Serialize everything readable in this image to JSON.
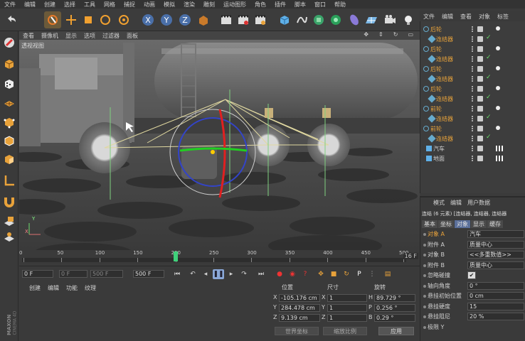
{
  "menu": [
    "文件",
    "编辑",
    "创建",
    "选择",
    "工具",
    "网格",
    "捕捉",
    "动画",
    "模拟",
    "渲染",
    "雕刻",
    "运动图形",
    "角色",
    "插件",
    "脚本",
    "窗口",
    "帮助"
  ],
  "viewport": {
    "menu": [
      "查看",
      "摄像机",
      "显示",
      "选项",
      "过滤器",
      "面板"
    ],
    "title": "透视视图",
    "axis_y": "Y",
    "axis_x": "X"
  },
  "object_manager": {
    "menu": [
      "文件",
      "编辑",
      "查看",
      "对象",
      "标签"
    ],
    "objects": [
      {
        "name": "后轮",
        "type": "null",
        "color": "#e8a23a"
      },
      {
        "name": "连结器",
        "type": "connector",
        "color": "#e8a23a"
      },
      {
        "name": "后轮",
        "type": "null",
        "color": "#e8a23a"
      },
      {
        "name": "连结器",
        "type": "connector",
        "color": "#e8a23a"
      },
      {
        "name": "后轮",
        "type": "null",
        "color": "#e8a23a"
      },
      {
        "name": "连结器",
        "type": "connector",
        "color": "#e8a23a"
      },
      {
        "name": "后轮",
        "type": "null",
        "color": "#e8a23a"
      },
      {
        "name": "连结器",
        "type": "connector",
        "color": "#e8a23a"
      },
      {
        "name": "前轮",
        "type": "null",
        "color": "#e8a23a"
      },
      {
        "name": "连结器",
        "type": "connector",
        "color": "#e8a23a"
      },
      {
        "name": "前轮",
        "type": "null",
        "color": "#e8a23a"
      },
      {
        "name": "连结器",
        "type": "connector",
        "color": "#e8a23a"
      },
      {
        "name": "汽车",
        "type": "object",
        "color": "#d0d0d0"
      },
      {
        "name": "地面",
        "type": "object",
        "color": "#d0d0d0"
      }
    ]
  },
  "attributes": {
    "menu": [
      "模式",
      "编辑",
      "用户数据"
    ],
    "header": "连结 (6 元素) [连结器, 连结器, 连结器",
    "tabs": [
      "基本",
      "坐标",
      "对象",
      "显示",
      "缓存"
    ],
    "active_tab": "对象",
    "rows": [
      {
        "label": "对象 A",
        "value": "汽车"
      },
      {
        "label": "附件 A",
        "value": "质量中心"
      },
      {
        "label": "对象 B",
        "value": "<<多重数值>>"
      },
      {
        "label": "附件 B",
        "value": "质量中心"
      },
      {
        "label": "忽略碰撞",
        "value": "✔"
      },
      {
        "label": "轴向角度",
        "value": "0 °"
      },
      {
        "label": "悬挂初始位置",
        "value": "0 cm"
      },
      {
        "label": "悬挂硬度",
        "value": "15"
      },
      {
        "label": "悬挂阻尼",
        "value": "20 %"
      },
      {
        "label": "极限 Y",
        "value": ""
      }
    ]
  },
  "timeline": {
    "ticks": [
      "0",
      "50",
      "100",
      "150",
      "200",
      "250",
      "300",
      "350",
      "400",
      "450",
      "500"
    ],
    "current_frame": 200,
    "end_label": "16 F"
  },
  "playback": {
    "start": "0 F",
    "range_start": "0 F",
    "range_end": "500 F",
    "end": "500 F"
  },
  "materials": {
    "menu": [
      "创建",
      "编辑",
      "功能",
      "纹理"
    ],
    "brand_line1": "MAXON",
    "brand_line2": "CINEMA 4D"
  },
  "coordinates": {
    "headers": [
      "位置",
      "尺寸",
      "旋转"
    ],
    "rows": [
      {
        "axis": "X",
        "pos": "-105.176 cm",
        "size_axis": "X",
        "size": "1",
        "rot_axis": "H",
        "rot": "89.729 °"
      },
      {
        "axis": "Y",
        "pos": "284.478 cm",
        "size_axis": "Y",
        "size": "1",
        "rot_axis": "P",
        "rot": "0.256 °"
      },
      {
        "axis": "Z",
        "pos": "9.139 cm",
        "size_axis": "Z",
        "size": "1",
        "rot_axis": "B",
        "rot": "0.29 °"
      }
    ],
    "mode1": "世界坐标",
    "mode2": "缩放比例",
    "apply": "应用"
  }
}
